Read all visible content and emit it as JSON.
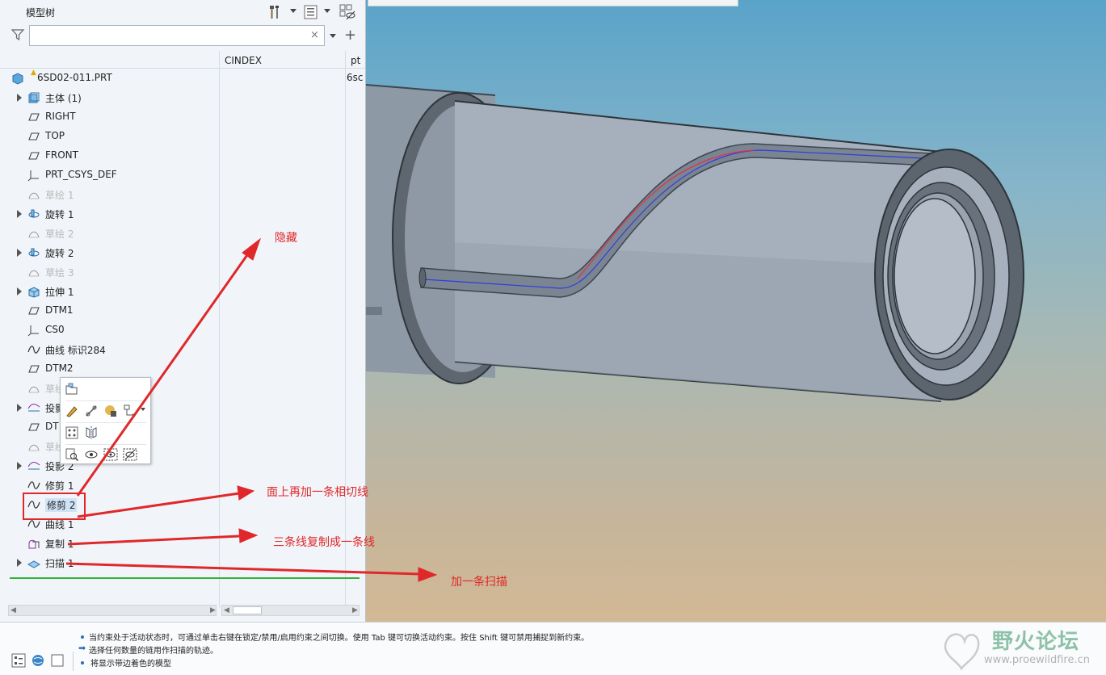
{
  "panel": {
    "title": "模型树",
    "search_value": "",
    "search_clear": "×",
    "add_symbol": "+"
  },
  "columns": {
    "cindex": "CINDEX",
    "pt": "pt"
  },
  "tree": {
    "root": {
      "label": "6SD02-011.PRT",
      "col2": "6sc"
    },
    "items": [
      {
        "label": "主体 (1)",
        "icon": "solid-body-icon",
        "expandable": true,
        "dim": false
      },
      {
        "label": "RIGHT",
        "icon": "datum-plane-icon",
        "expandable": false,
        "dim": false
      },
      {
        "label": "TOP",
        "icon": "datum-plane-icon",
        "expandable": false,
        "dim": false
      },
      {
        "label": "FRONT",
        "icon": "datum-plane-icon",
        "expandable": false,
        "dim": false
      },
      {
        "label": "PRT_CSYS_DEF",
        "icon": "csys-icon",
        "expandable": false,
        "dim": false
      },
      {
        "label": "草绘 1",
        "icon": "sketch-icon",
        "expandable": false,
        "dim": true
      },
      {
        "label": "旋转 1",
        "icon": "revolve-icon",
        "expandable": true,
        "dim": false
      },
      {
        "label": "草绘 2",
        "icon": "sketch-icon",
        "expandable": false,
        "dim": true
      },
      {
        "label": "旋转 2",
        "icon": "revolve-icon",
        "expandable": true,
        "dim": false
      },
      {
        "label": "草绘 3",
        "icon": "sketch-icon",
        "expandable": false,
        "dim": true
      },
      {
        "label": "拉伸 1",
        "icon": "extrude-icon",
        "expandable": true,
        "dim": false
      },
      {
        "label": "DTM1",
        "icon": "datum-plane-icon",
        "expandable": false,
        "dim": false
      },
      {
        "label": "CS0",
        "icon": "csys-icon",
        "expandable": false,
        "dim": false
      },
      {
        "label": "曲线 标识284",
        "icon": "curve-icon",
        "expandable": false,
        "dim": false
      },
      {
        "label": "DTM2",
        "icon": "datum-plane-icon",
        "expandable": false,
        "dim": false
      },
      {
        "label": "草绘",
        "icon": "sketch-icon",
        "expandable": false,
        "dim": true
      },
      {
        "label": "投影",
        "icon": "projection-icon",
        "expandable": true,
        "dim": false
      },
      {
        "label": "DT",
        "icon": "datum-plane-icon",
        "expandable": false,
        "dim": false
      },
      {
        "label": "草绘",
        "icon": "sketch-icon",
        "expandable": false,
        "dim": true
      },
      {
        "label": "投影 2",
        "icon": "projection-icon",
        "expandable": true,
        "dim": false
      },
      {
        "label": "修剪 1",
        "icon": "curve-icon",
        "expandable": false,
        "dim": false
      },
      {
        "label": "修剪 2",
        "icon": "curve-icon",
        "expandable": false,
        "dim": false,
        "selected": true
      },
      {
        "label": "曲线 1",
        "icon": "curve-icon",
        "expandable": false,
        "dim": false
      },
      {
        "label": "复制 1",
        "icon": "copy-icon",
        "expandable": false,
        "dim": false
      },
      {
        "label": "扫描 1",
        "icon": "sweep-icon",
        "expandable": true,
        "dim": false
      }
    ]
  },
  "annotations": {
    "hide": "隐藏",
    "add_tangent": "面上再加一条相切线",
    "copy_merge": "三条线复制成一条线",
    "add_sweep": "加一条扫描"
  },
  "status": {
    "messages": [
      "当约束处于活动状态时，可通过单击右键在锁定/禁用/启用约束之间切换。使用 Tab 键可切换活动约束。按住 Shift 键可禁用捕捉到新约束。",
      "选择任何数量的链用作扫描的轨迹。",
      "将显示带边着色的模型"
    ]
  },
  "watermark": {
    "title": "野火论坛",
    "url": "www.proewildfire.cn"
  },
  "colors": {
    "annotation": "#e0282a",
    "insert_line": "#33b233",
    "selection": "#cfe3f7"
  }
}
